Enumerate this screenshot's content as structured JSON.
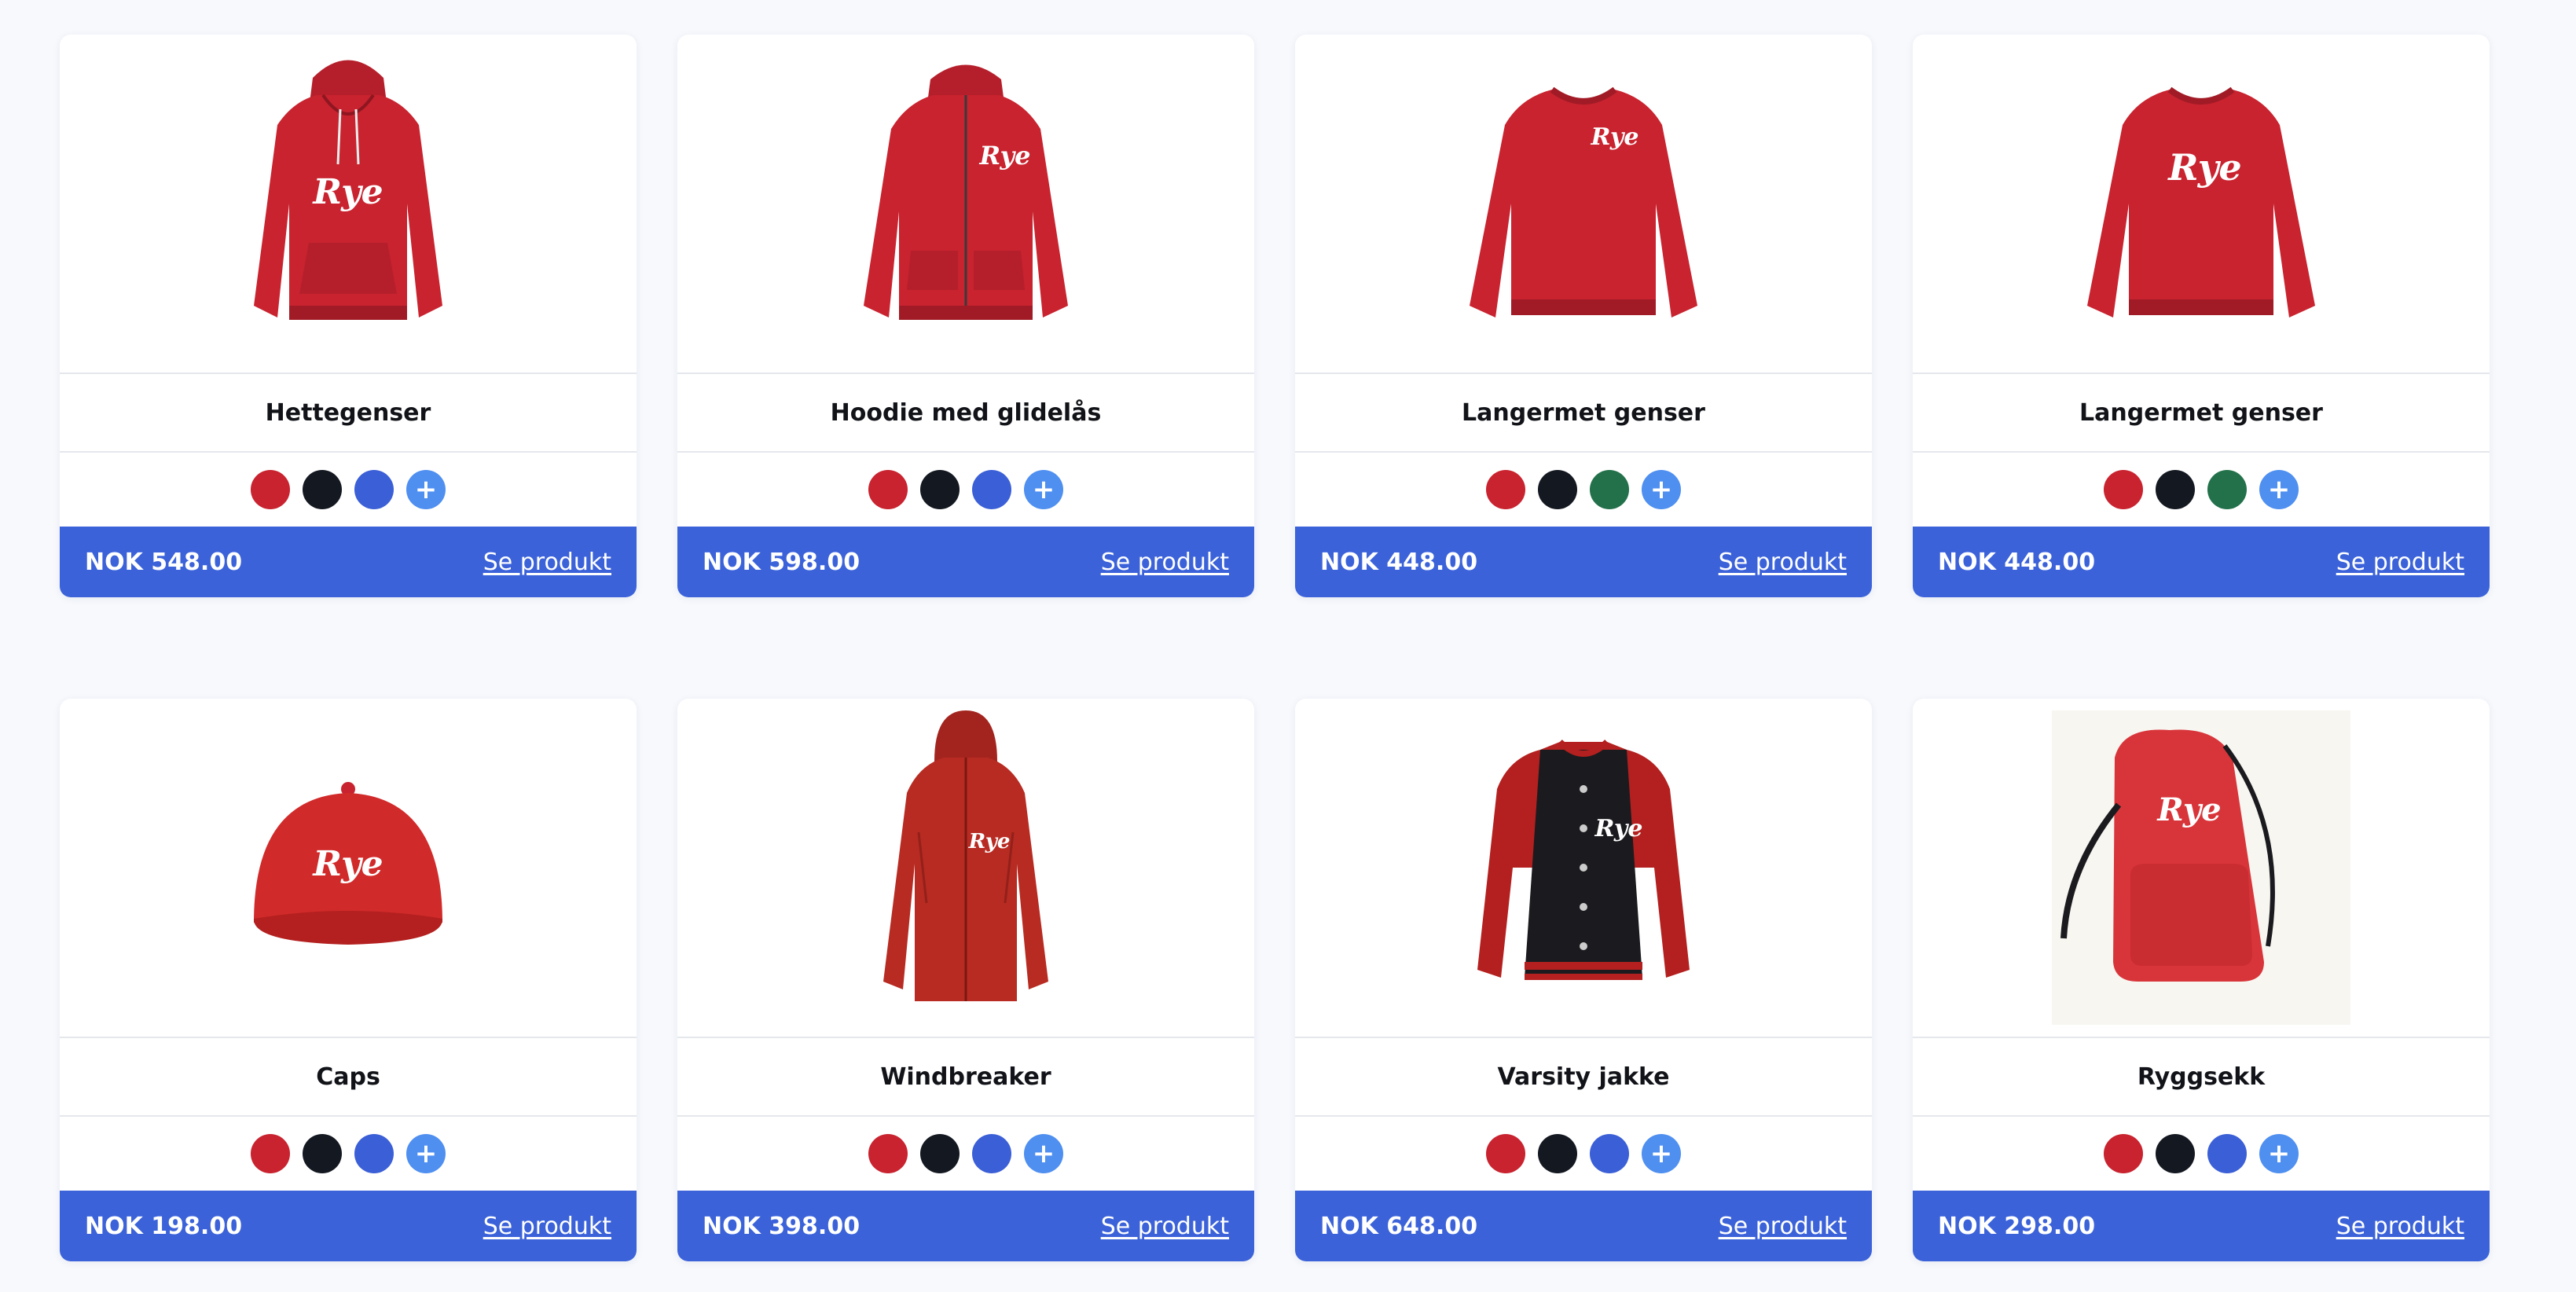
{
  "colors": {
    "red": "#c8232f",
    "black": "#141821",
    "blue": "#3b5fd6",
    "green": "#23714a",
    "more": "#4f8ff0",
    "footer": "#3b62d9"
  },
  "products": [
    {
      "name": "Hettegenser",
      "price": "NOK 548.00",
      "link": "Se produkt",
      "swatches": [
        "red",
        "black",
        "blue"
      ],
      "more": "+",
      "logo": "Rye",
      "image": "hoodie-image"
    },
    {
      "name": "Hoodie med glidelås",
      "price": "NOK 598.00",
      "link": "Se produkt",
      "swatches": [
        "red",
        "black",
        "blue"
      ],
      "more": "+",
      "logo": "Rye",
      "image": "zip-hoodie-image"
    },
    {
      "name": "Langermet genser",
      "price": "NOK 448.00",
      "link": "Se produkt",
      "swatches": [
        "red",
        "black",
        "green"
      ],
      "more": "+",
      "logo": "Rye",
      "image": "sweater-image"
    },
    {
      "name": "Langermet genser",
      "price": "NOK 448.00",
      "link": "Se produkt",
      "swatches": [
        "red",
        "black",
        "green"
      ],
      "more": "+",
      "logo": "Rye",
      "image": "sweater-image"
    },
    {
      "name": "Caps",
      "price": "NOK 198.00",
      "link": "Se produkt",
      "swatches": [
        "red",
        "black",
        "blue"
      ],
      "more": "+",
      "logo": "Rye",
      "image": "cap-image"
    },
    {
      "name": "Windbreaker",
      "price": "NOK 398.00",
      "link": "Se produkt",
      "swatches": [
        "red",
        "black",
        "blue"
      ],
      "more": "+",
      "logo": "Rye",
      "image": "windbreaker-image"
    },
    {
      "name": "Varsity jakke",
      "price": "NOK 648.00",
      "link": "Se produkt",
      "swatches": [
        "red",
        "black",
        "blue"
      ],
      "more": "+",
      "logo": "Rye",
      "image": "varsity-jacket-image"
    },
    {
      "name": "Ryggsekk",
      "price": "NOK 298.00",
      "link": "Se produkt",
      "swatches": [
        "red",
        "black",
        "blue"
      ],
      "more": "+",
      "logo": "Rye",
      "image": "backpack-image"
    }
  ]
}
